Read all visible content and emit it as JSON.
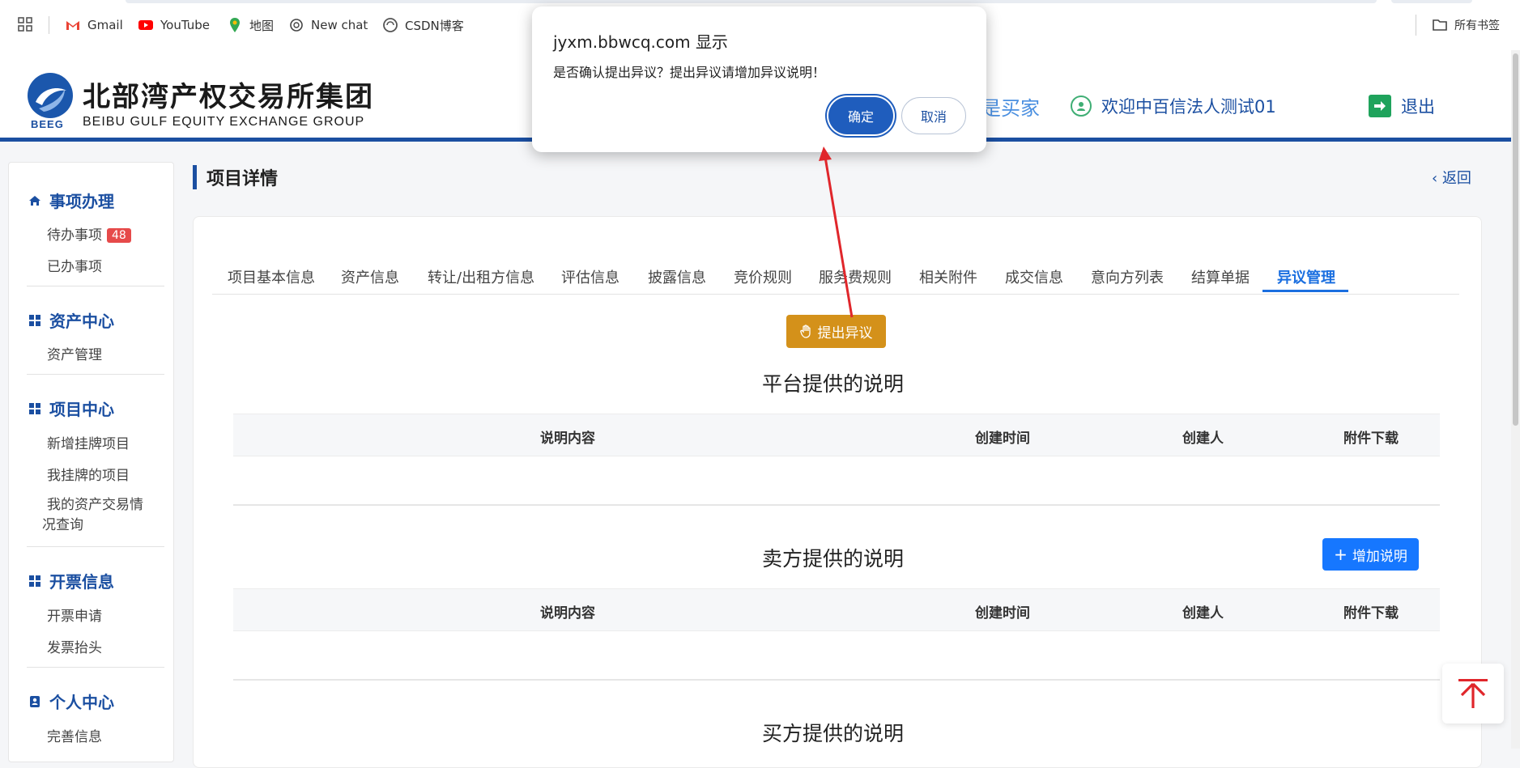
{
  "browser": {
    "bookmarks": [
      {
        "label": "Gmail",
        "icon": "gmail-icon"
      },
      {
        "label": "YouTube",
        "icon": "youtube-icon"
      },
      {
        "label": "地图",
        "icon": "maps-icon"
      },
      {
        "label": "New chat",
        "icon": "openai-icon"
      },
      {
        "label": "CSDN博客",
        "icon": "csdn-icon"
      }
    ],
    "all_bookmarks_label": "所有书签"
  },
  "header": {
    "logo_cn": "北部湾产权交易所集团",
    "logo_en": "BEIBU GULF EQUITY EXCHANGE GROUP",
    "logo_abbr": "BEEG",
    "role_text": "是买家",
    "welcome_text": "欢迎中百信法人测试01",
    "logout_label": "退出"
  },
  "sidebar": {
    "groups": [
      {
        "title": "事项办理",
        "icon": "home-icon",
        "items": [
          {
            "label": "待办事项",
            "badge": "48"
          },
          {
            "label": "已办事项"
          }
        ]
      },
      {
        "title": "资产中心",
        "icon": "grid-icon",
        "items": [
          {
            "label": "资产管理"
          }
        ]
      },
      {
        "title": "项目中心",
        "icon": "grid-icon",
        "items": [
          {
            "label": "新增挂牌项目"
          },
          {
            "label": "我挂牌的项目"
          },
          {
            "label": "我的资产交易情况查询"
          }
        ]
      },
      {
        "title": "开票信息",
        "icon": "grid-icon",
        "items": [
          {
            "label": "开票申请"
          },
          {
            "label": "发票抬头"
          }
        ]
      },
      {
        "title": "个人中心",
        "icon": "user-card-icon",
        "items": [
          {
            "label": "完善信息"
          }
        ]
      }
    ]
  },
  "main": {
    "page_title": "项目详情",
    "back_label": "返回",
    "tabs": [
      {
        "label": "项目基本信息"
      },
      {
        "label": "资产信息"
      },
      {
        "label": "转让/出租方信息"
      },
      {
        "label": "评估信息"
      },
      {
        "label": "披露信息"
      },
      {
        "label": "竞价规则"
      },
      {
        "label": "服务费规则"
      },
      {
        "label": "相关附件"
      },
      {
        "label": "成交信息"
      },
      {
        "label": "意向方列表"
      },
      {
        "label": "结算单据"
      },
      {
        "label": "异议管理"
      }
    ],
    "active_tab": "异议管理",
    "objection_button": "提出异议",
    "sections": [
      {
        "title": "平台提供的说明"
      },
      {
        "title": "卖方提供的说明",
        "action": "增加说明"
      },
      {
        "title": "买方提供的说明"
      }
    ],
    "table_columns": [
      "说明内容",
      "创建时间",
      "创建人",
      "附件下载"
    ]
  },
  "dialog": {
    "title": "jyxm.bbwcq.com 显示",
    "message": "是否确认提出异议？提出异议请增加异议说明！",
    "ok_label": "确定",
    "cancel_label": "取消"
  },
  "colors": {
    "brand_blue": "#1b4fa1",
    "active_tab": "#1b6fe0",
    "objection_button": "#d4911a",
    "add_button": "#1677ff",
    "badge": "#e64a4a",
    "annotation_arrow": "#e0262b"
  }
}
